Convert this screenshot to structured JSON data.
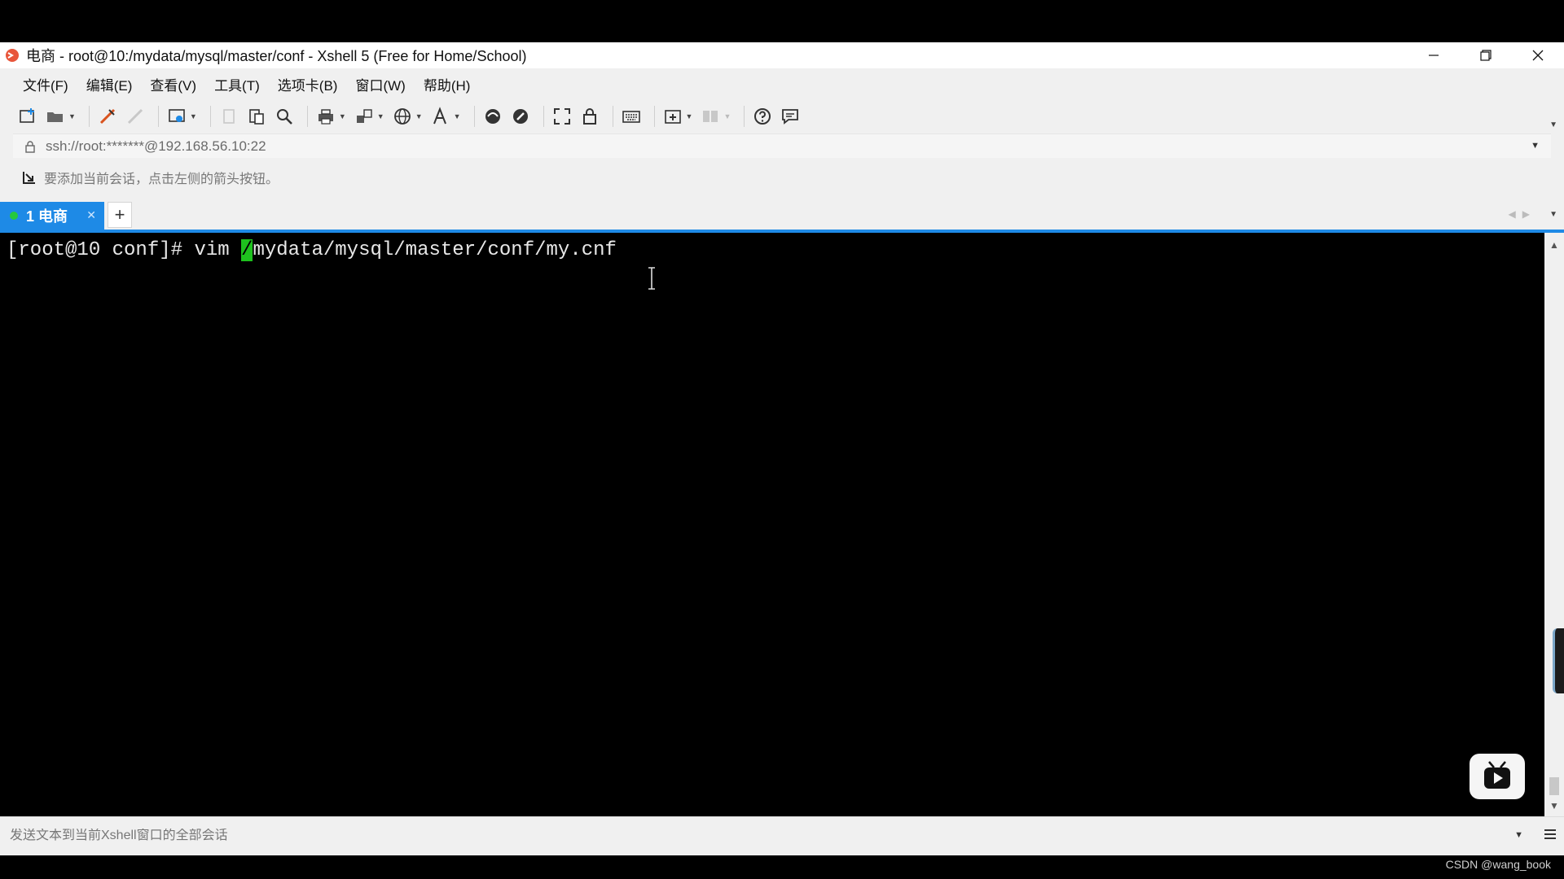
{
  "window": {
    "title": "电商 - root@10:/mydata/mysql/master/conf - Xshell 5 (Free for Home/School)"
  },
  "menu": [
    "文件(F)",
    "编辑(E)",
    "查看(V)",
    "工具(T)",
    "选项卡(B)",
    "窗口(W)",
    "帮助(H)"
  ],
  "address_bar": {
    "text": "ssh://root:*******@192.168.56.10:22"
  },
  "info_bar": {
    "text": "要添加当前会话，点击左侧的箭头按钮。"
  },
  "tabs": [
    {
      "label": "1 电商",
      "active": true,
      "status_color": "#25c93d"
    }
  ],
  "terminal": {
    "prompt": "[root@10 conf]# vim ",
    "cursor_char": "/",
    "rest": "mydata/mysql/master/conf/my.cnf"
  },
  "compose_bar": {
    "placeholder": "发送文本到当前Xshell窗口的全部会话"
  },
  "watermark": "CSDN @wang_book",
  "colors": {
    "accent": "#1e8ae6",
    "cursor": "#1ec21e",
    "terminal_bg": "#000000"
  },
  "icons": [
    "new-session-icon",
    "open-folder-icon",
    "connect-icon",
    "disconnect-icon",
    "properties-icon",
    "copy-icon",
    "paste-icon",
    "find-icon",
    "print-icon",
    "transfer-icon",
    "globe-icon",
    "font-icon",
    "xftp-icon",
    "xmanager-icon",
    "fullscreen-icon",
    "lock-icon",
    "keyboard-icon",
    "new-tab-icon",
    "layout-icon",
    "help-icon",
    "chat-icon"
  ]
}
